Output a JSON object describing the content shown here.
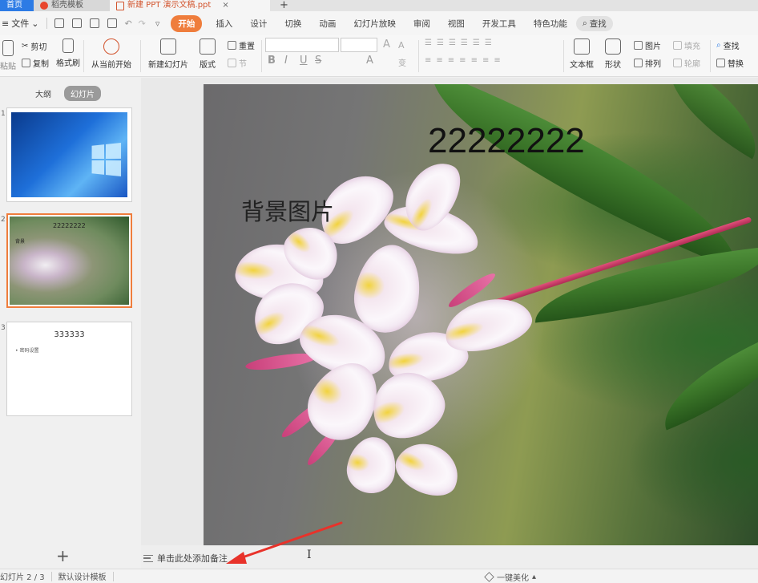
{
  "titlebar": {
    "tabs": [
      {
        "label": "首页"
      },
      {
        "label": "稻壳模板"
      },
      {
        "label": "新建 PPT 演示文稿.ppt"
      }
    ],
    "close_icon": "×",
    "new_tab_icon": "+"
  },
  "menubar": {
    "file_label": "文件",
    "items": [
      "开始",
      "插入",
      "设计",
      "切换",
      "动画",
      "幻灯片放映",
      "审阅",
      "视图",
      "开发工具",
      "特色功能"
    ],
    "active": "开始",
    "search_label": "查找"
  },
  "ribbon": {
    "paste_label": "粘贴",
    "cut_label": "剪切",
    "copy_label": "复制",
    "format_painter_label": "格式刷",
    "from_current_label": "从当前开始",
    "new_slide_label": "新建幻灯片",
    "layout_label": "版式",
    "reset_label": "重置",
    "section_label": "节",
    "textbox_label": "文本框",
    "shape_label": "形状",
    "picture_label": "图片",
    "arrange_label": "排列",
    "fill_label": "填充",
    "outline_label": "轮廓",
    "find_label": "查找",
    "replace_label": "替换",
    "font_size_up": "A",
    "font_size_down": "A",
    "bold": "B",
    "italic": "I",
    "underline": "U",
    "strike": "S",
    "font_color": "A",
    "change_label": "变"
  },
  "left_panel": {
    "tab_outline": "大纲",
    "tab_slides": "幻灯片",
    "slides": [
      {
        "number": "1"
      },
      {
        "number": "2",
        "text": "22222222",
        "sub": "背景"
      },
      {
        "number": "3",
        "title": "333333",
        "bullet": "• 密码设置"
      }
    ],
    "add_icon": "+"
  },
  "slide": {
    "number_text": "22222222",
    "cn_text": "背景图片"
  },
  "notes": {
    "label": "单击此处添加备注",
    "cursor": "I"
  },
  "statusbar": {
    "slide_indicator": "幻灯片 2 / 3",
    "template_label": "默认设计模板",
    "beautify_label": "一键美化"
  },
  "colors": {
    "accent": "#ef7d3c",
    "home_tab": "#2c7be5",
    "arrow": "#e8322a"
  }
}
